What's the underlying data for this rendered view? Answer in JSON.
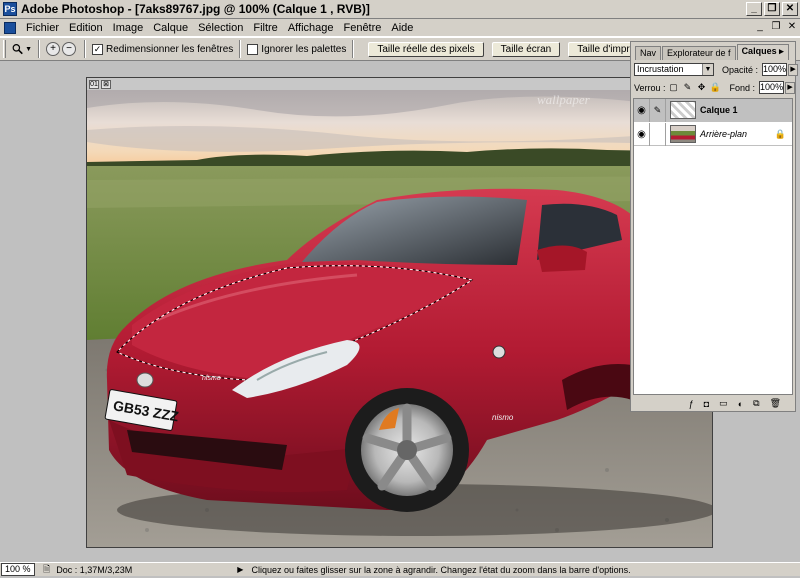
{
  "titlebar": {
    "title": "Adobe Photoshop - [7aks89767.jpg @ 100% (Calque 1 , RVB)]",
    "buttons": [
      "_",
      "❐",
      "✕"
    ]
  },
  "menubar": {
    "items": [
      "Fichier",
      "Edition",
      "Image",
      "Calque",
      "Sélection",
      "Filtre",
      "Affichage",
      "Fenêtre",
      "Aide"
    ],
    "doc_buttons": [
      "_",
      "❐",
      "✕"
    ]
  },
  "optionsbar": {
    "zoom_in": "+",
    "zoom_out": "−",
    "resize_windows": {
      "label": "Redimensionner les fenêtres",
      "checked": true
    },
    "ignore_palettes": {
      "label": "Ignorer les palettes",
      "checked": false
    },
    "actual_pixels": "Taille réelle des pixels",
    "fit_screen": "Taille écran",
    "print_size": "Taille d'impression"
  },
  "document": {
    "icons": [
      "01",
      "⊠"
    ],
    "plate_text": "GB53 ZZZ",
    "badge_text": "nismo",
    "watermark": "wallpaper"
  },
  "palette": {
    "tabs": [
      "Nav",
      "Explorateur de f",
      "Calques ▸"
    ],
    "blend_mode": "Incrustation",
    "opacity_label": "Opacité :",
    "opacity_value": "100%",
    "lock_label": "Verrou :",
    "fill_label": "Fond :",
    "fill_value": "100%",
    "layers": [
      {
        "name": "Calque 1",
        "selected": true
      },
      {
        "name": "Arrière-plan",
        "selected": false
      }
    ]
  },
  "statusbar": {
    "zoom": "100 %",
    "doc": "Doc : 1,37M/3,23M",
    "hint": "Cliquez ou faites glisser sur la zone à agrandir. Changez l'état du zoom dans la barre d'options."
  },
  "colors": {
    "car": "#b31b33",
    "sky": "#dcd6d0",
    "grass": "#6c8a3a",
    "gravel": "#8e8980"
  }
}
